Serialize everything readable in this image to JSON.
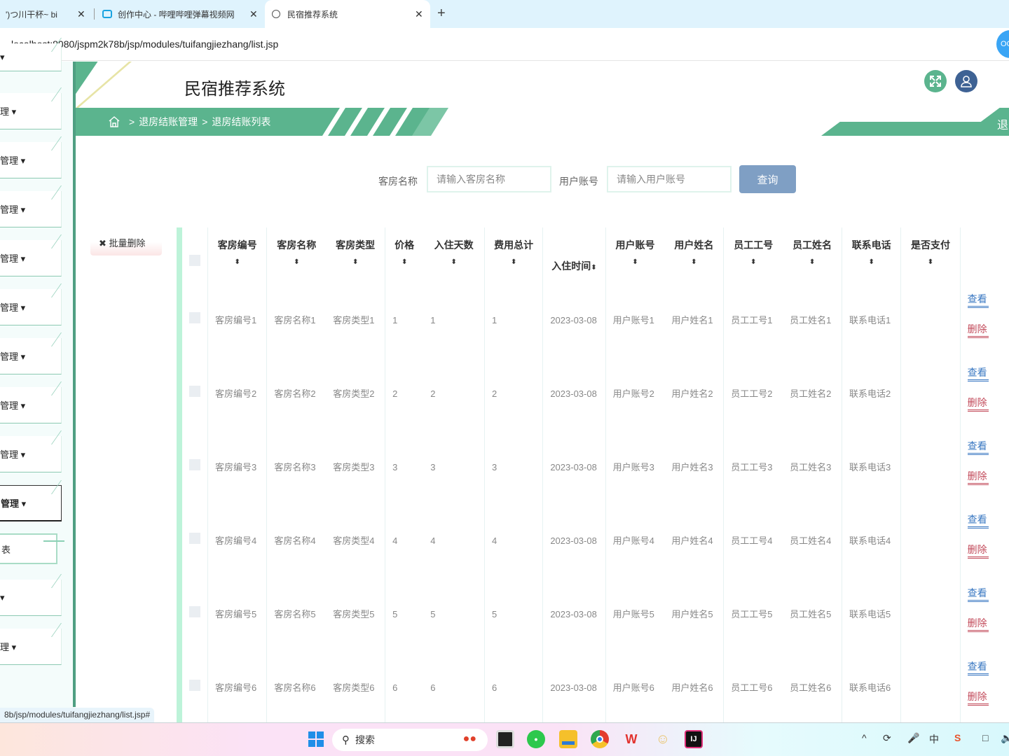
{
  "browser": {
    "tabs": [
      {
        "label": "')つ川干杯~ bi",
        "active": false
      },
      {
        "label": "创作中心 - 哔哩哔哩弹幕视频网",
        "active": false
      },
      {
        "label": "民宿推荐系统",
        "active": true
      }
    ],
    "new_tab": "+",
    "close_glyph": "✕",
    "url": "localhost:8080/jspm2k78b/jsp/modules/tuifangjiezhang/list.jsp",
    "profile_label": "OC",
    "status_url": "8b/jsp/modules/tuifangjiezhang/list.jsp#"
  },
  "sidebar": {
    "items": [
      {
        "label": "▾"
      },
      {
        "label": "理 ▾"
      },
      {
        "label": "管理 ▾"
      },
      {
        "label": "管理 ▾"
      },
      {
        "label": "管理 ▾"
      },
      {
        "label": "管理 ▾"
      },
      {
        "label": "管理 ▾"
      },
      {
        "label": "管理 ▾"
      },
      {
        "label": "管理 ▾"
      },
      {
        "label": "管理 ▾",
        "active": true
      },
      {
        "label": "▾"
      },
      {
        "label": "理 ▾"
      }
    ],
    "sub_item": "表"
  },
  "header": {
    "title": "民宿推荐系统",
    "fullscreen_icon": "expand-icon",
    "user_icon": "user-icon",
    "logout_label": "退出"
  },
  "breadcrumb": {
    "home_icon": "home-icon",
    "separator": ">",
    "items": [
      "退房结账管理",
      "退房结账列表"
    ]
  },
  "search": {
    "room_name_label": "客房名称",
    "room_name_placeholder": "请输入客房名称",
    "room_name_value": "",
    "user_account_label": "用户账号",
    "user_account_placeholder": "请输入用户账号",
    "user_account_value": "",
    "query_button": "查询"
  },
  "actions": {
    "batch_delete": "✖ 批量删除"
  },
  "table": {
    "sort_glyph": "⬍",
    "columns": [
      "客房编号",
      "客房名称",
      "客房类型",
      "价格",
      "入住天数",
      "费用总计",
      "入住时间",
      "用户账号",
      "用户姓名",
      "员工工号",
      "员工姓名",
      "联系电话",
      "是否支付"
    ],
    "view_label": "查看",
    "delete_label": "删除",
    "rows": [
      [
        "客房编号1",
        "客房名称1",
        "客房类型1",
        "1",
        "1",
        "1",
        "2023-03-08",
        "用户账号1",
        "用户姓名1",
        "员工工号1",
        "员工姓名1",
        "联系电话1",
        ""
      ],
      [
        "客房编号2",
        "客房名称2",
        "客房类型2",
        "2",
        "2",
        "2",
        "2023-03-08",
        "用户账号2",
        "用户姓名2",
        "员工工号2",
        "员工姓名2",
        "联系电话2",
        ""
      ],
      [
        "客房编号3",
        "客房名称3",
        "客房类型3",
        "3",
        "3",
        "3",
        "2023-03-08",
        "用户账号3",
        "用户姓名3",
        "员工工号3",
        "员工姓名3",
        "联系电话3",
        ""
      ],
      [
        "客房编号4",
        "客房名称4",
        "客房类型4",
        "4",
        "4",
        "4",
        "2023-03-08",
        "用户账号4",
        "用户姓名4",
        "员工工号4",
        "员工姓名4",
        "联系电话4",
        ""
      ],
      [
        "客房编号5",
        "客房名称5",
        "客房类型5",
        "5",
        "5",
        "5",
        "2023-03-08",
        "用户账号5",
        "用户姓名5",
        "员工工号5",
        "员工姓名5",
        "联系电话5",
        ""
      ],
      [
        "客房编号6",
        "客房名称6",
        "客房类型6",
        "6",
        "6",
        "6",
        "2023-03-08",
        "用户账号6",
        "用户姓名6",
        "员工工号6",
        "员工姓名6",
        "联系电话6",
        ""
      ]
    ]
  },
  "taskbar": {
    "search_label": "搜索",
    "apps": [
      "windows-start",
      "search",
      "task-view",
      "wechat",
      "file-explorer",
      "chrome",
      "wps",
      "app-yellow",
      "intellij"
    ],
    "tray": {
      "chevron": "^",
      "ime": "中"
    }
  }
}
